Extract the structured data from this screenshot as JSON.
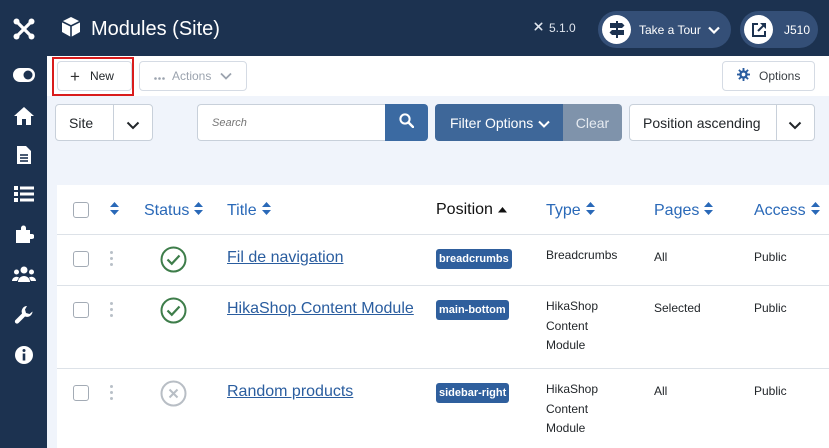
{
  "header": {
    "title": "Modules (Site)",
    "version": "5.1.0",
    "tour_label": "Take a Tour",
    "user_label": "J510"
  },
  "sidebar": {
    "items": [
      {
        "icon": "joomla-logo-icon"
      },
      {
        "icon": "toggle-icon"
      },
      {
        "icon": "home-icon"
      },
      {
        "icon": "document-icon"
      },
      {
        "icon": "list-icon"
      },
      {
        "icon": "puzzle-icon"
      },
      {
        "icon": "users-icon"
      },
      {
        "icon": "wrench-icon"
      },
      {
        "icon": "info-icon"
      }
    ]
  },
  "toolbar": {
    "new_label": "New",
    "actions_label": "Actions",
    "options_label": "Options"
  },
  "filters": {
    "client_value": "Site",
    "search_placeholder": "Search",
    "filter_options_label": "Filter Options",
    "clear_label": "Clear",
    "ordering_value": "Position ascending"
  },
  "table": {
    "columns": {
      "status": "Status",
      "title": "Title",
      "position": "Position",
      "type": "Type",
      "pages": "Pages",
      "access": "Access"
    },
    "rows": [
      {
        "status": "published",
        "title": "Fil de navigation",
        "position": "breadcrumbs",
        "type": "Breadcrumbs",
        "pages": "All",
        "access": "Public"
      },
      {
        "status": "published",
        "title": "HikaShop Content Module",
        "position": "main-bottom",
        "type_lines": [
          "HikaShop",
          "Content",
          "Module"
        ],
        "pages": "Selected",
        "access": "Public"
      },
      {
        "status": "unpublished",
        "title": "Random products",
        "position": "sidebar-right",
        "type_lines": [
          "HikaShop",
          "Content",
          "Module"
        ],
        "pages": "All",
        "access": "Public"
      }
    ]
  },
  "colors": {
    "sidebar_bg": "#1c3250",
    "accent": "#2a69b8",
    "badge": "#2f5f9d",
    "published": "#3e7d4a",
    "highlight": "#d91c1c"
  }
}
